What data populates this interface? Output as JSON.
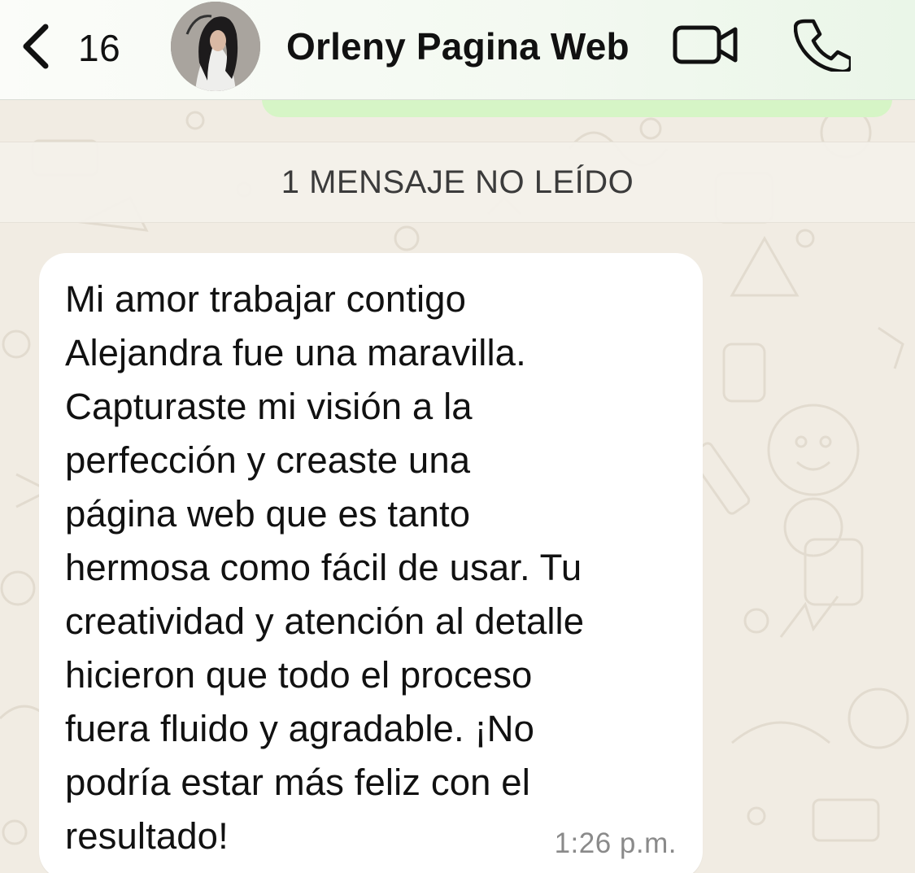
{
  "header": {
    "back_count": "16",
    "contact_name": "Orleny Pagina Web"
  },
  "divider": {
    "unread_label": "1 MENSAJE NO LEÍDO"
  },
  "message": {
    "lines": [
      "Mi amor trabajar contigo",
      "Alejandra fue una maravilla.",
      "Capturaste mi visión a la",
      "perfección y creaste una",
      "página web que es tanto",
      "hermosa como fácil de usar. Tu",
      "creatividad y atención al detalle",
      "hicieron que todo el proceso",
      "fuera fluido y agradable. ¡No",
      "podría estar más feliz con el",
      "resultado!"
    ],
    "time": "1:26 p.m."
  },
  "icons": {
    "back": "chevron-left-icon",
    "video": "video-camera-icon",
    "call": "phone-icon"
  },
  "colors": {
    "wallpaper": "#f1ece3",
    "outgoing_bubble": "#d6f5c6",
    "incoming_bubble": "#ffffff",
    "header": "#f3f9f1"
  }
}
